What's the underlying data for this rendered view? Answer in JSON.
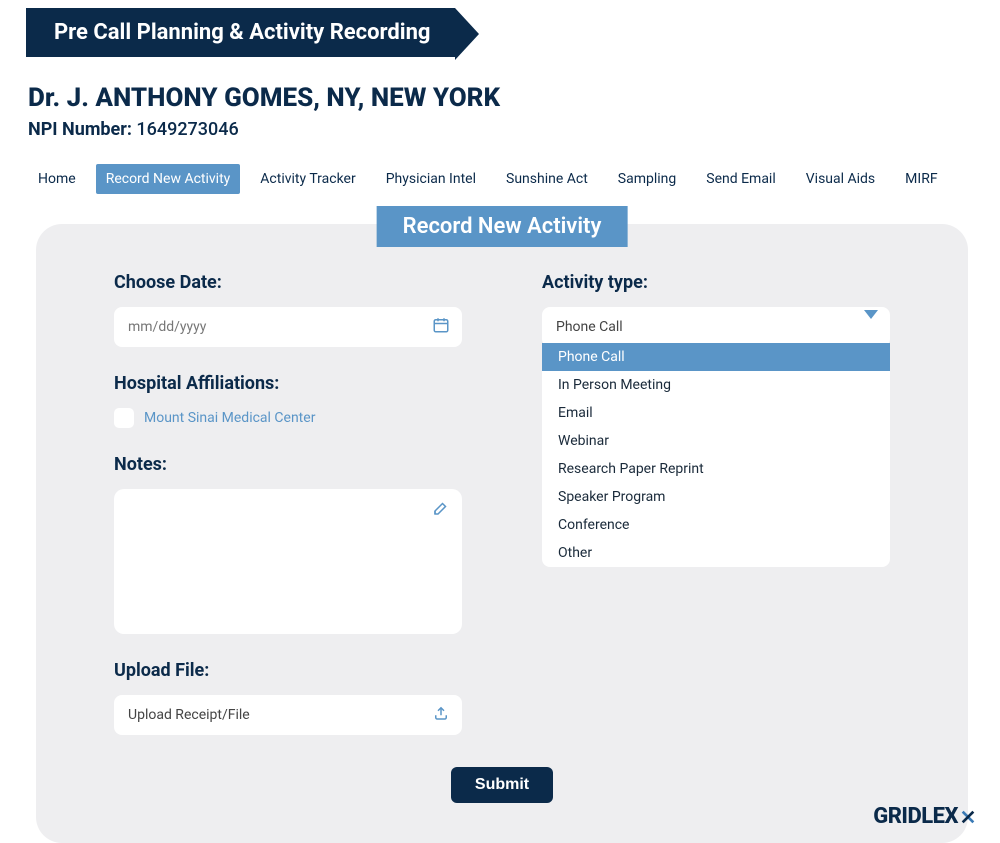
{
  "header": {
    "ribbon": "Pre Call Planning & Activity Recording"
  },
  "doctor": {
    "name": "Dr. J. ANTHONY GOMES, NY, NEW YORK",
    "npi_label": "NPI Number:",
    "npi_value": "1649273046"
  },
  "tabs": [
    "Home",
    "Record New Activity",
    "Activity Tracker",
    "Physician Intel",
    "Sunshine Act",
    "Sampling",
    "Send Email",
    "Visual Aids",
    "MIRF"
  ],
  "active_tab": "Record New Activity",
  "panel": {
    "title": "Record New Activity",
    "date": {
      "label": "Choose Date:",
      "placeholder": "mm/dd/yyyy"
    },
    "activity": {
      "label": "Activity type:",
      "selected": "Phone Call",
      "options": [
        "Phone Call",
        "In Person Meeting",
        "Email",
        "Webinar",
        "Research Paper Reprint",
        "Speaker Program",
        "Conference",
        "Other"
      ]
    },
    "hospital": {
      "label": "Hospital Affiliations:",
      "option": "Mount Sinai Medical Center"
    },
    "notes": {
      "label": "Notes:"
    },
    "upload": {
      "label": "Upload File:",
      "placeholder": "Upload Receipt/File"
    },
    "submit": "Submit"
  },
  "brand": "GRIDLEX"
}
